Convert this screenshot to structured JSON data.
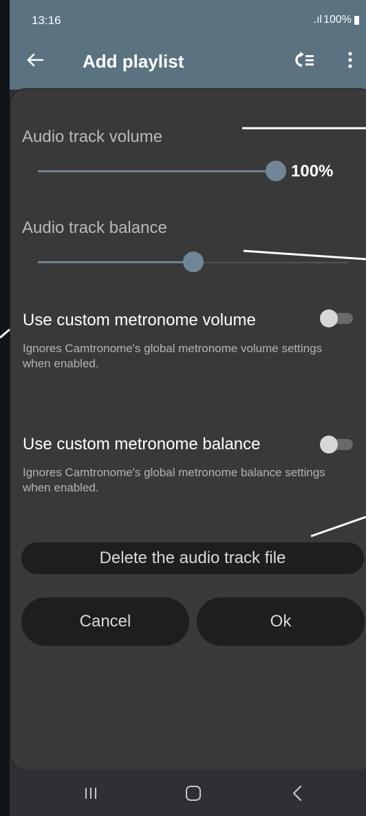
{
  "status": {
    "time": "13:16",
    "signal": ".ıl",
    "battery_pct": "100%"
  },
  "appbar": {
    "title": "Add playlist"
  },
  "dialog": {
    "volume": {
      "label": "Audio track volume",
      "value_text": "100%",
      "level": 1.0
    },
    "balance": {
      "label": "Audio track balance",
      "level": 0.5
    },
    "custom_volume": {
      "title": "Use custom metronome volume",
      "description": "Ignores Camtronome's global metronome volume settings when enabled.",
      "enabled": false
    },
    "custom_balance": {
      "title": "Use custom metronome balance",
      "description": "Ignores Camtronome's global metronome balance settings when enabled.",
      "enabled": false
    },
    "delete_label": "Delete the audio track file",
    "cancel_label": "Cancel",
    "ok_label": "Ok"
  },
  "colors": {
    "appbar": "#5b7381",
    "dialog": "#393939",
    "accent": "#718797"
  }
}
